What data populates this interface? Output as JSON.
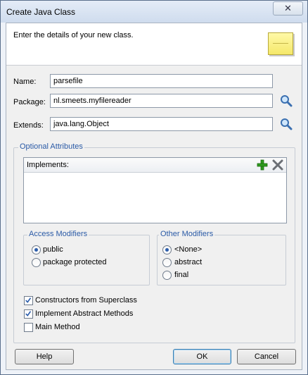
{
  "window": {
    "title": "Create Java Class"
  },
  "header": {
    "text": "Enter the details of your new class."
  },
  "fields": {
    "name": {
      "label": "Name:",
      "value": "parsefile"
    },
    "package": {
      "label": "Package:",
      "value": "nl.smeets.myfilereader"
    },
    "extends": {
      "label": "Extends:",
      "value": "java.lang.Object"
    }
  },
  "optional": {
    "legend": "Optional Attributes",
    "implements_label": "Implements:",
    "access": {
      "legend": "Access Modifiers",
      "options": [
        "public",
        "package protected"
      ],
      "selected": "public"
    },
    "other": {
      "legend": "Other Modifiers",
      "options": [
        "<None>",
        "abstract",
        "final"
      ],
      "selected": "<None>"
    },
    "checks": [
      {
        "label": "Constructors from Superclass",
        "checked": true
      },
      {
        "label": "Implement Abstract Methods",
        "checked": true
      },
      {
        "label": "Main Method",
        "checked": false
      }
    ]
  },
  "buttons": {
    "help": "Help",
    "ok": "OK",
    "cancel": "Cancel"
  },
  "icons": {
    "close": "close-icon",
    "note": "note-icon",
    "search": "magnifier-icon",
    "add": "plus-icon",
    "remove": "x-icon"
  },
  "colors": {
    "accent": "#2a5aa6",
    "add_green": "#2e9b1e"
  }
}
